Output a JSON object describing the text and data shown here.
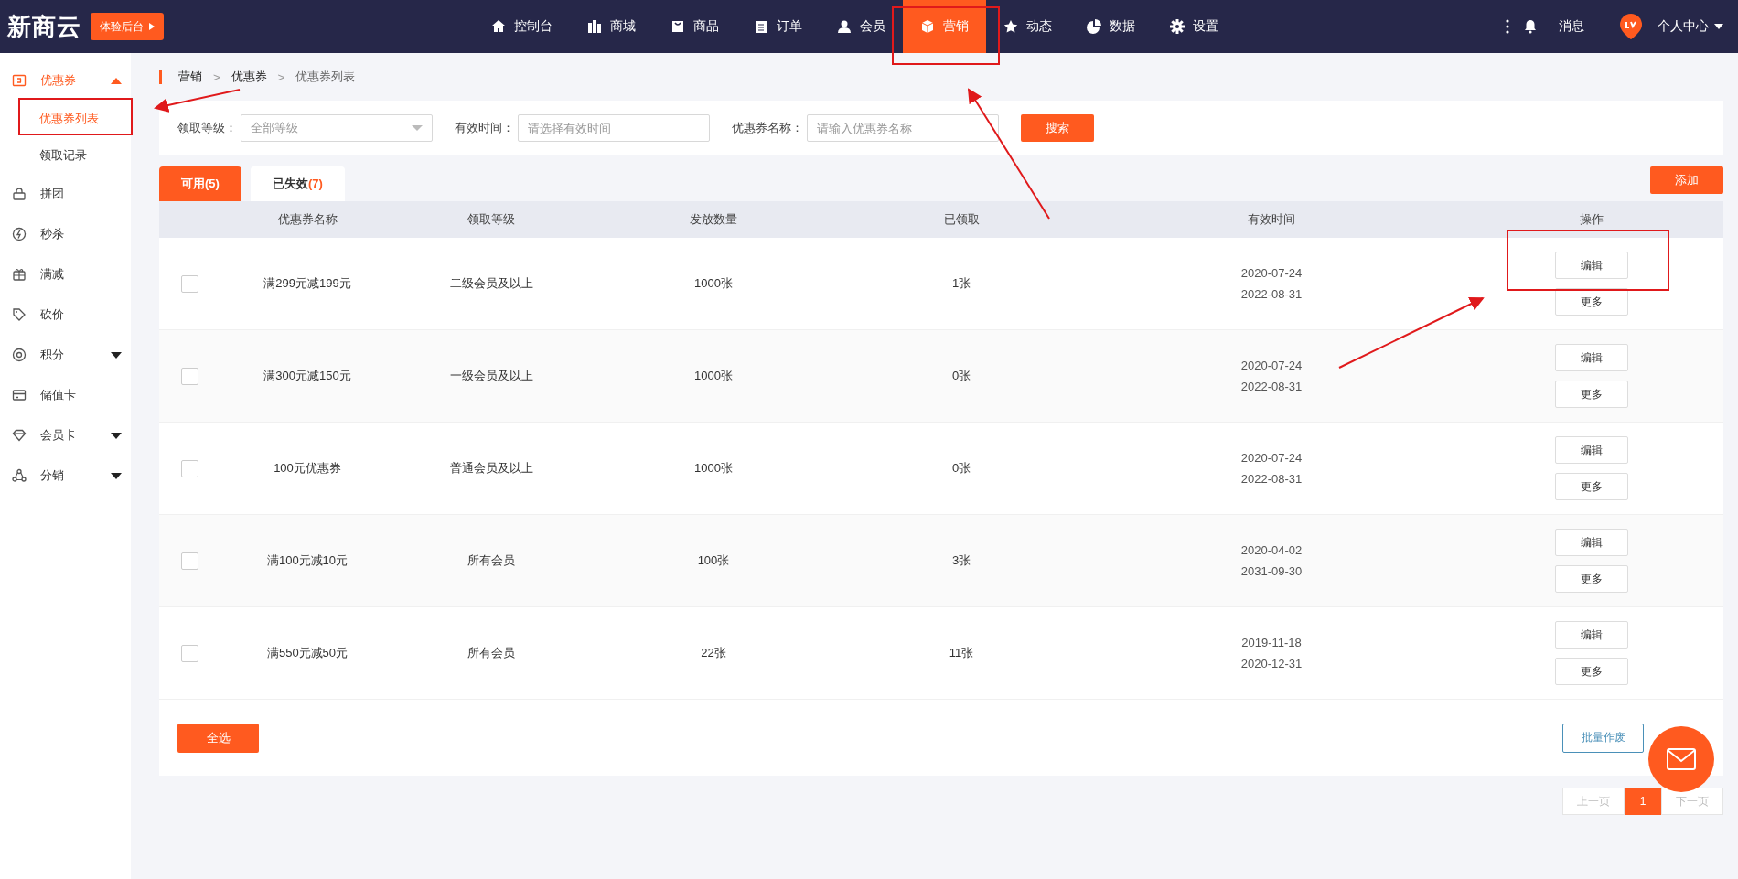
{
  "logo": "新商云",
  "trial_button": "体验后台",
  "nav": [
    {
      "label": "控制台",
      "selected": false
    },
    {
      "label": "商城",
      "selected": false
    },
    {
      "label": "商品",
      "selected": false
    },
    {
      "label": "订单",
      "selected": false
    },
    {
      "label": "会员",
      "selected": false
    },
    {
      "label": "营销",
      "selected": true
    },
    {
      "label": "动态",
      "selected": false
    },
    {
      "label": "数据",
      "selected": false
    },
    {
      "label": "设置",
      "selected": false
    }
  ],
  "top_right": {
    "message": "消息",
    "profile": "个人中心"
  },
  "sidebar": [
    {
      "label": "优惠券",
      "selected": true,
      "expanded": true,
      "children": [
        {
          "label": "优惠券列表",
          "selected": true
        },
        {
          "label": "领取记录",
          "selected": false
        }
      ]
    },
    {
      "label": "拼团",
      "selected": false
    },
    {
      "label": "秒杀",
      "selected": false
    },
    {
      "label": "满减",
      "selected": false
    },
    {
      "label": "砍价",
      "selected": false
    },
    {
      "label": "积分",
      "selected": false,
      "expanded": false
    },
    {
      "label": "储值卡",
      "selected": false
    },
    {
      "label": "会员卡",
      "selected": false,
      "expanded": false
    },
    {
      "label": "分销",
      "selected": false,
      "expanded": false
    }
  ],
  "breadcrumb": [
    "营销",
    "优惠券",
    "优惠券列表"
  ],
  "breadcrumb_separator": ">",
  "filters": [
    {
      "kind": "select",
      "label": "领取等级：",
      "value": "全部等级"
    },
    {
      "kind": "input",
      "label": "有效时间：",
      "placeholder": "请选择有效时间"
    },
    {
      "kind": "input",
      "label": "优惠券名称：",
      "placeholder": "请输入优惠券名称"
    }
  ],
  "search_button": "搜索",
  "tabs": [
    {
      "label": "可用",
      "count": "(5)",
      "selected": true
    },
    {
      "label": "已失效",
      "count": "(7)",
      "selected": false
    }
  ],
  "add_button": "添加",
  "table": {
    "columns": [
      "优惠券名称",
      "领取等级",
      "发放数量",
      "已领取",
      "有效时间",
      "操作"
    ],
    "rows": [
      {
        "checked": false,
        "name": "满299元减199元",
        "level": "二级会员及以上",
        "quantity": "1000张",
        "claimed": "1张",
        "start": "2020-07-24",
        "end": "2022-08-31",
        "actions": [
          "编辑",
          "更多"
        ]
      },
      {
        "checked": false,
        "name": "满300元减150元",
        "level": "一级会员及以上",
        "quantity": "1000张",
        "claimed": "0张",
        "start": "2020-07-24",
        "end": "2022-08-31",
        "actions": [
          "编辑",
          "更多"
        ]
      },
      {
        "checked": false,
        "name": "100元优惠券",
        "level": "普通会员及以上",
        "quantity": "1000张",
        "claimed": "0张",
        "start": "2020-07-24",
        "end": "2022-08-31",
        "actions": [
          "编辑",
          "更多"
        ]
      },
      {
        "checked": false,
        "name": "满100元减10元",
        "level": "所有会员",
        "quantity": "100张",
        "claimed": "3张",
        "start": "2020-04-02",
        "end": "2031-09-30",
        "actions": [
          "编辑",
          "更多"
        ]
      },
      {
        "checked": false,
        "name": "满550元减50元",
        "level": "所有会员",
        "quantity": "22张",
        "claimed": "11张",
        "start": "2019-11-18",
        "end": "2020-12-31",
        "actions": [
          "编辑",
          "更多"
        ]
      }
    ]
  },
  "select_all_button": "全选",
  "batch_void_button": "批量作废",
  "pagination": {
    "prev": "上一页",
    "pages": [
      {
        "label": "1",
        "selected": true
      }
    ],
    "next": "下一页"
  }
}
